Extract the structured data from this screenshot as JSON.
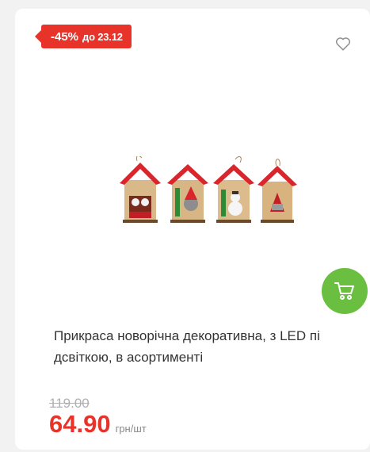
{
  "product": {
    "badge": {
      "discount": "-45%",
      "until": "до 23.12"
    },
    "title": "Прикраса новорічна декоративна, з LED пі дсвіткою, в асортименті",
    "old_price": "119.00",
    "price": "64.90",
    "unit": "грн/шт"
  },
  "icons": {
    "favorite": "heart-outline-icon",
    "cart": "shopping-cart-icon"
  },
  "colors": {
    "accent_red": "#e8332b",
    "cart_green": "#6abf40",
    "old_price_gray": "#b0b0b0"
  }
}
